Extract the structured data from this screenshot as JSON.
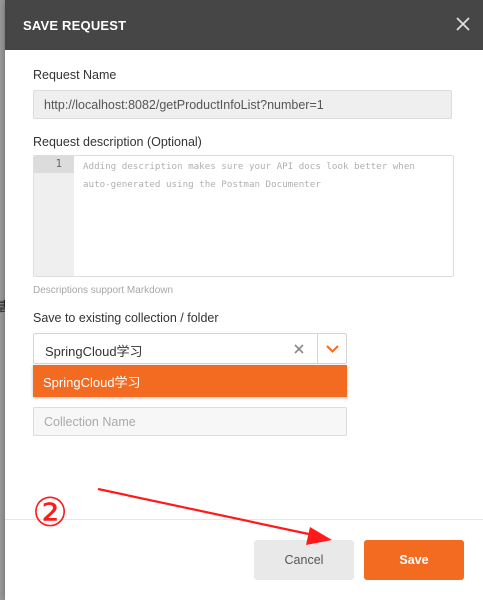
{
  "background": {
    "edge_glyph": "書"
  },
  "dialog": {
    "title": "SAVE REQUEST",
    "close_icon": "close-icon"
  },
  "request_name": {
    "label": "Request Name",
    "value": "http://localhost:8082/getProductInfoList?number=1"
  },
  "description": {
    "label": "Request description (Optional)",
    "line_number": "1",
    "placeholder_line1": "Adding description makes sure your API docs look better when",
    "placeholder_line2": "auto-generated using the Postman Documenter",
    "hint": "Descriptions support Markdown"
  },
  "collection": {
    "label": "Save to existing collection / folder",
    "selected_value": "SpringCloud学习",
    "clear_icon": "clear-x-icon",
    "toggle_icon": "chevron-down-icon",
    "options": [
      "SpringCloud学习"
    ],
    "new_collection_placeholder": "Collection Name"
  },
  "footer": {
    "cancel_label": "Cancel",
    "save_label": "Save"
  },
  "annotation": {
    "marker_text": "②",
    "color": "#ff1a1a"
  },
  "colors": {
    "accent": "#f26b21",
    "header_bg": "#464646"
  }
}
